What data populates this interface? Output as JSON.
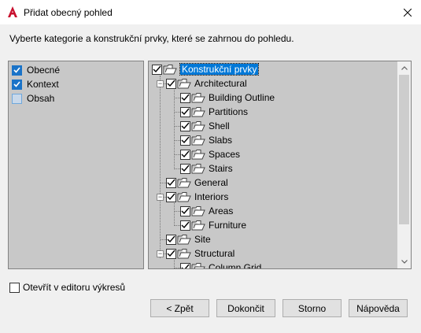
{
  "window": {
    "title": "Přidat obecný pohled",
    "instruction": "Vyberte kategorie a konstrukční prvky, které se zahrnou do pohledu."
  },
  "categories": [
    {
      "label": "Obecné",
      "checked": true
    },
    {
      "label": "Kontext",
      "checked": true
    },
    {
      "label": "Obsah",
      "checked": false
    }
  ],
  "tree": {
    "root": {
      "label": "Konstrukční prvky",
      "checked": true,
      "selected": true
    },
    "items": [
      {
        "label": "Architectural",
        "level": 1,
        "expanded": true,
        "checked": true
      },
      {
        "label": "Building Outline",
        "level": 2,
        "checked": true
      },
      {
        "label": "Partitions",
        "level": 2,
        "checked": true
      },
      {
        "label": "Shell",
        "level": 2,
        "checked": true
      },
      {
        "label": "Slabs",
        "level": 2,
        "checked": true
      },
      {
        "label": "Spaces",
        "level": 2,
        "checked": true
      },
      {
        "label": "Stairs",
        "level": 2,
        "checked": true
      },
      {
        "label": "General",
        "level": 1,
        "checked": true
      },
      {
        "label": "Interiors",
        "level": 1,
        "expanded": true,
        "checked": true
      },
      {
        "label": "Areas",
        "level": 2,
        "checked": true
      },
      {
        "label": "Furniture",
        "level": 2,
        "checked": true
      },
      {
        "label": "Site",
        "level": 1,
        "checked": true
      },
      {
        "label": "Structural",
        "level": 1,
        "expanded": true,
        "checked": true
      },
      {
        "label": "Column Grid",
        "level": 2,
        "checked": true
      }
    ]
  },
  "open_in_editor": {
    "label": "Otevřít v editoru výkresů",
    "checked": false
  },
  "buttons": {
    "back": "< Zpět",
    "finish": "Dokončit",
    "cancel": "Storno",
    "help": "Nápověda"
  },
  "colors": {
    "selection": "#0078d7",
    "checkbox_blue": "#1a73c8",
    "panel_bg": "#c8c8c8",
    "app_icon_red": "#c8102e"
  }
}
